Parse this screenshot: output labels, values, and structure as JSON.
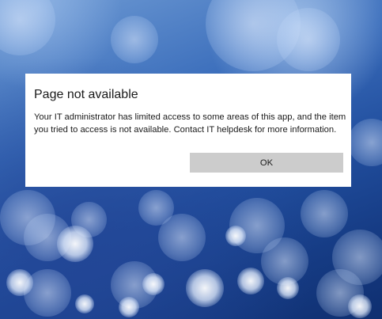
{
  "dialog": {
    "title": "Page not available",
    "message": "Your IT administrator has limited access to some areas of this app, and the item you tried to access is not available. Contact IT helpdesk for more information.",
    "ok_label": "OK"
  },
  "theme": {
    "background_accent": "#214e9e",
    "dialog_bg": "#ffffff",
    "button_bg": "#cccccc"
  }
}
